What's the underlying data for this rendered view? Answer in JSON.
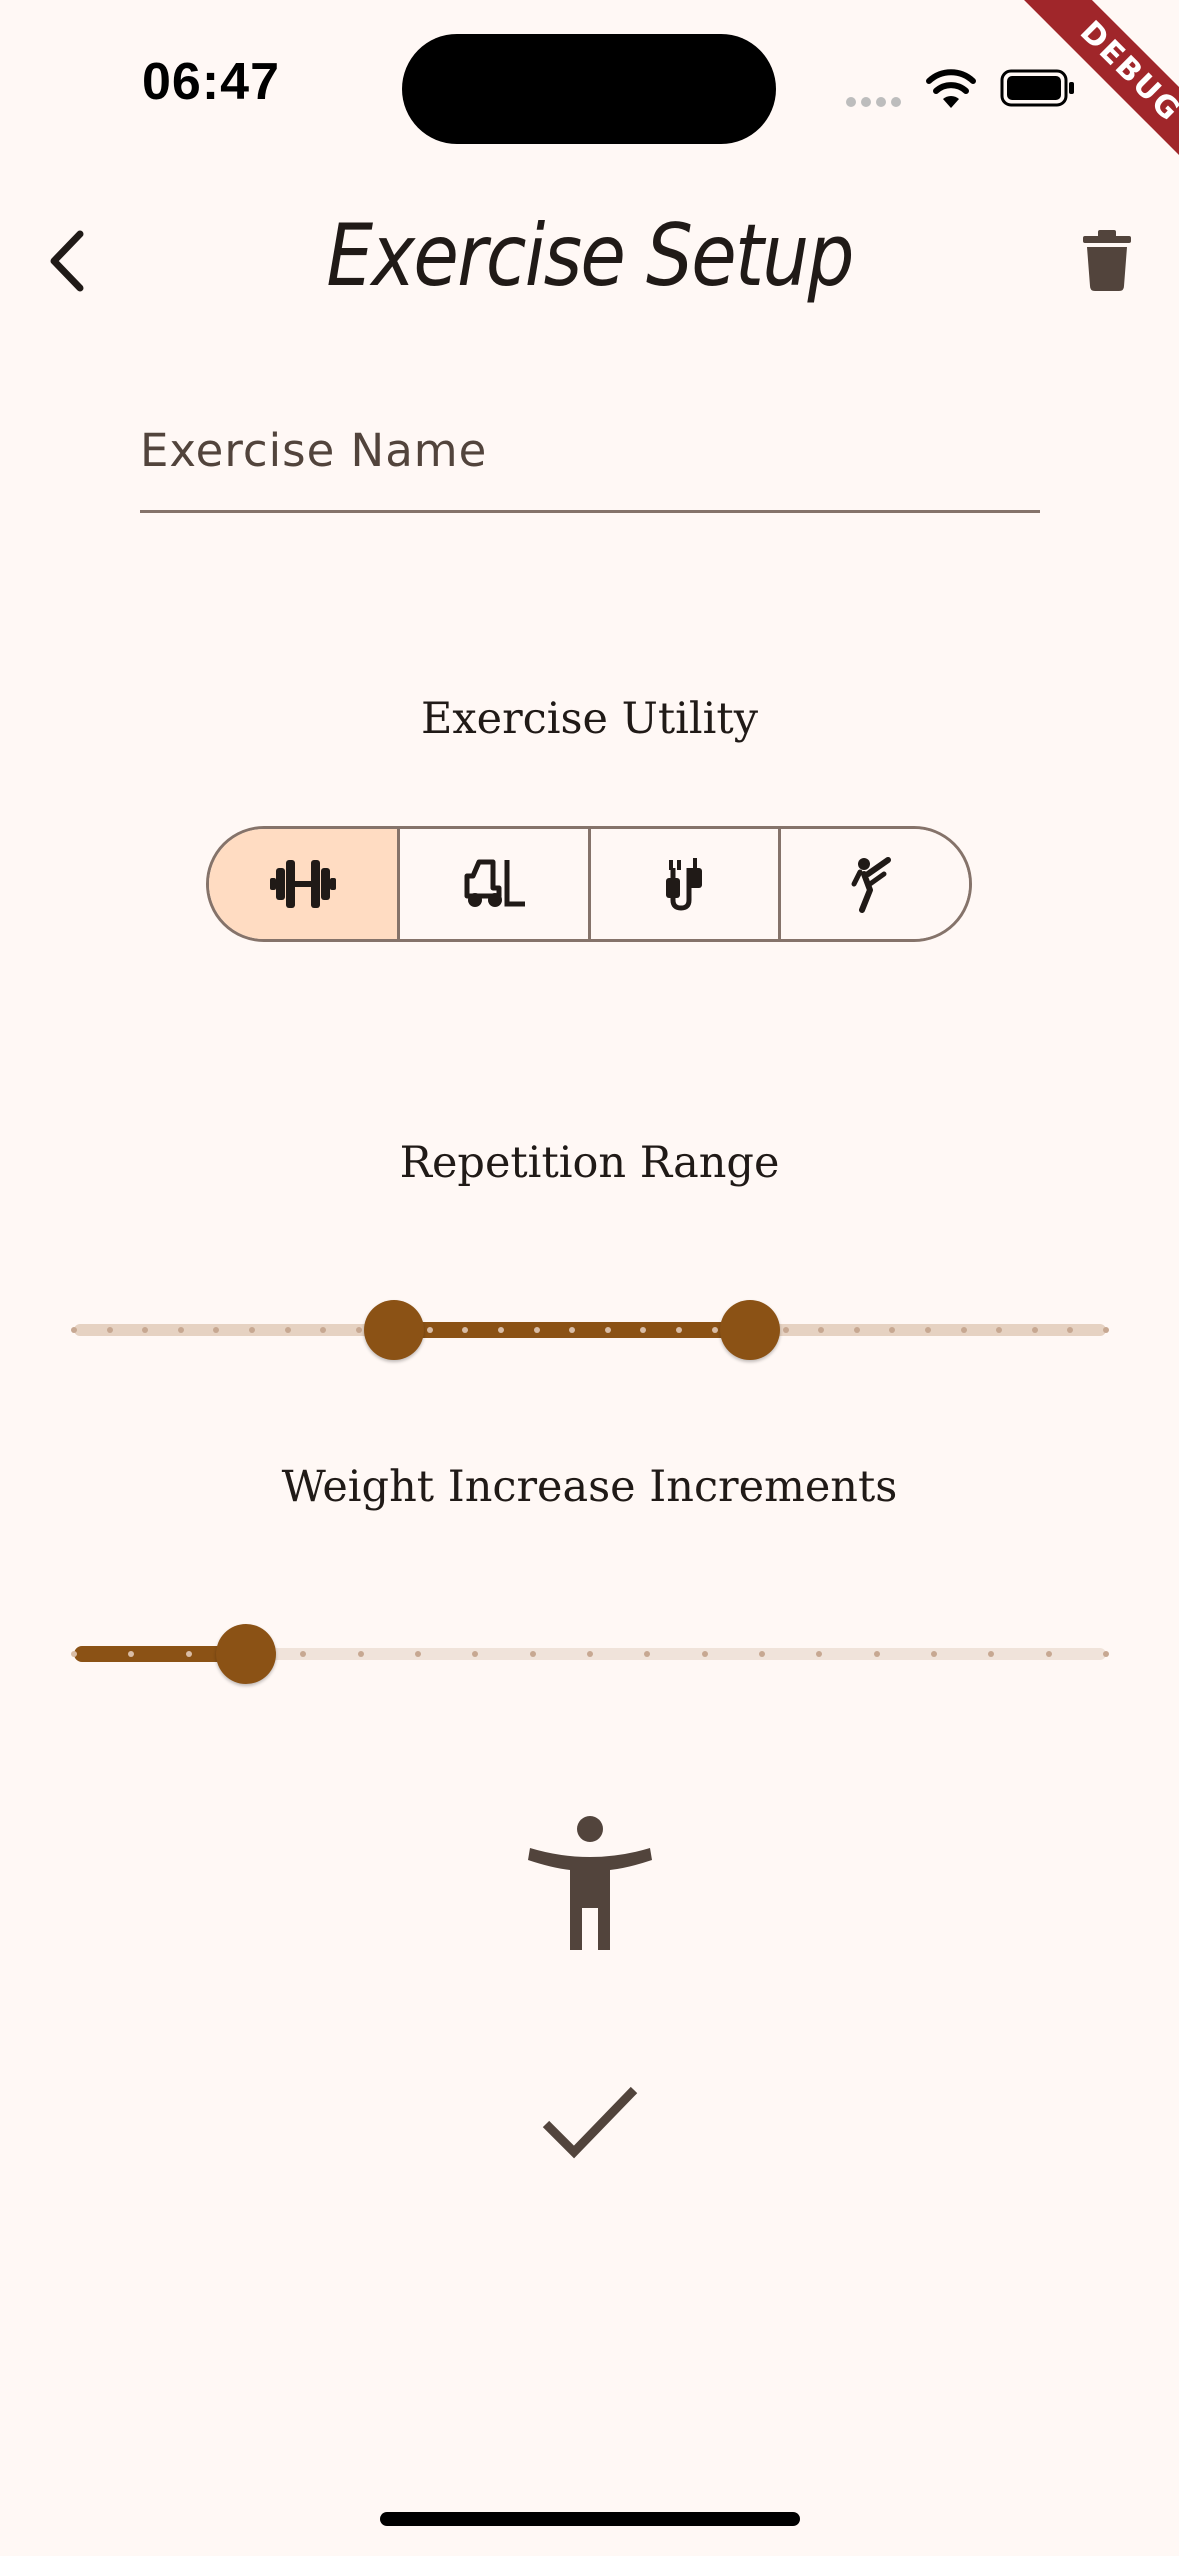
{
  "status_bar": {
    "time": "06:47",
    "icons": [
      "cellular-signal-icon",
      "wifi-icon",
      "battery-icon"
    ]
  },
  "debug_banner": "DEBUG",
  "header": {
    "title": "Exercise Setup",
    "back_icon": "chevron-left-icon",
    "delete_icon": "trash-icon"
  },
  "form": {
    "name_placeholder": "Exercise Name",
    "name_value": ""
  },
  "utility": {
    "label": "Exercise Utility",
    "options": [
      {
        "icon": "dumbbell-icon",
        "selected": true
      },
      {
        "icon": "forklift-icon",
        "selected": false
      },
      {
        "icon": "cable-icon",
        "selected": false
      },
      {
        "icon": "martial-arts-kick-icon",
        "selected": false
      }
    ]
  },
  "repetition_range": {
    "label": "Repetition Range",
    "divisions": 29,
    "start_step": 9,
    "end_step": 19
  },
  "weight_increments": {
    "label": "Weight Increase Increments",
    "divisions": 18,
    "value_step": 3
  },
  "footer_icons": [
    "accessibility-icon",
    "check-icon"
  ],
  "colors": {
    "background": "#FFF8F5",
    "primary": "#8B5215",
    "selected_segment": "#FFDCC2",
    "outline": "#85736A",
    "on_surface": "#201A17",
    "icon": "#52443C"
  }
}
